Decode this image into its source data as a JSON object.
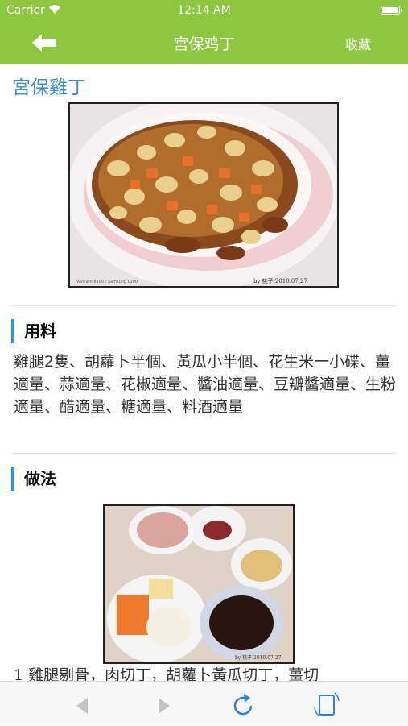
{
  "status_bar": {
    "carrier": "Carrier",
    "time": "12:14 AM"
  },
  "nav": {
    "back_icon": "back-arrow-icon",
    "title": "宫保鸡丁",
    "favorite_label": "收藏"
  },
  "recipe": {
    "title": "宮保雞丁",
    "hero_image": {
      "caption_left": "Vivicam 8100 / Samsung L100",
      "caption_right": "by 桃子 2010.07.27"
    },
    "ingredients_heading": "用料",
    "ingredients_text": "雞腿2隻、胡蘿卜半個、黃瓜小半個、花生米一小碟、薑適量、蒜適量、花椒適量、醬油適量、豆瓣醬適量、生粉適量、醋適量、糖適量、料酒適量",
    "method_heading": "做法",
    "method_image": {
      "caption_right": "by 桃子 2010.07.27"
    },
    "step1_text": "1 雞腿剔骨，肉切丁，胡蘿卜黃瓜切丁，薑切"
  },
  "toolbar": {
    "back_icon": "left-triangle-icon",
    "forward_icon": "right-triangle-icon",
    "reload_icon": "reload-icon",
    "rotate_icon": "rotate-device-icon"
  },
  "colors": {
    "nav_green": "#8dc63f",
    "accent_blue": "#2f92e0",
    "title_blue": "#3a8fd8"
  }
}
